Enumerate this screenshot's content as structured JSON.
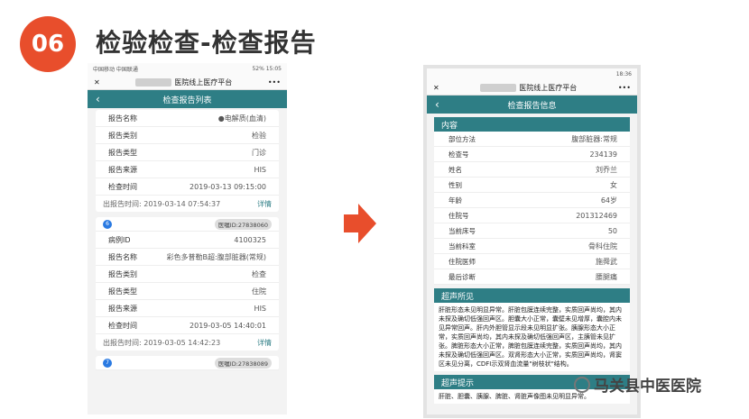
{
  "slide": {
    "badge": "06",
    "title": "检验检查-检查报告"
  },
  "left_phone": {
    "status_left": "中国移动 中国联通",
    "status_right": "52% 15:05",
    "app_title": "医院线上医疗平台",
    "nav_title": "检查报告列表",
    "card1": {
      "rows": [
        {
          "label": "报告名称",
          "value": "●电解质(血清)"
        },
        {
          "label": "报告类别",
          "value": "检验"
        },
        {
          "label": "报告类型",
          "value": "门诊"
        },
        {
          "label": "报告来源",
          "value": "HIS"
        },
        {
          "label": "检查时间",
          "value": "2019-03-13 09:15:00"
        }
      ],
      "footer_time": "出报告时间: 2019-03-14 07:54:37",
      "detail": "详情"
    },
    "card2": {
      "index": "6",
      "tag": "医嘱ID:27838060",
      "rows": [
        {
          "label": "病例ID",
          "value": "4100325"
        },
        {
          "label": "报告名称",
          "value": "彩色多普勒B超:腹部脏器(常规)"
        },
        {
          "label": "报告类别",
          "value": "检查"
        },
        {
          "label": "报告类型",
          "value": "住院"
        },
        {
          "label": "报告来源",
          "value": "HIS"
        },
        {
          "label": "检查时间",
          "value": "2019-03-05 14:40:01"
        }
      ],
      "footer_time": "出报告时间: 2019-03-05 14:42:23",
      "detail": "详情"
    },
    "card3": {
      "index": "7",
      "tag": "医嘱ID:27838089"
    }
  },
  "right_phone": {
    "status_right": "18:36",
    "app_title": "医院线上医疗平台",
    "nav_title": "检查报告信息",
    "content_head": "内容",
    "rows": [
      {
        "label": "部位方法",
        "value": "腹部脏器:常规"
      },
      {
        "label": "检查号",
        "value": "234139"
      },
      {
        "label": "姓名",
        "value": "刘乔兰"
      },
      {
        "label": "性别",
        "value": "女"
      },
      {
        "label": "年龄",
        "value": "64岁"
      },
      {
        "label": "住院号",
        "value": "201312469"
      },
      {
        "label": "当前床号",
        "value": "50"
      },
      {
        "label": "当前科室",
        "value": "骨科住院"
      },
      {
        "label": "住院医师",
        "value": "施舜武"
      },
      {
        "label": "最后诊断",
        "value": "腰腿痛"
      }
    ],
    "findings_head": "超声所见",
    "findings": "肝脏形态未见明显异常。肝脏包膜连续完整，实质回声尚均，其内未探及确切低强回声区。胆囊大小正常，囊壁未见增厚，囊腔内未见异常回声。肝内外胆管显示段未见明显扩张。胰腺形态大小正常，实质回声尚均，其内未探及确切低强回声区，主胰管未见扩张。脾脏形态大小正常，脾脏包膜连续完整，实质回声尚均，其内未探及确切低强回声区。双肾形态大小正常，实质回声尚均，肾窦区未见分离，CDFI示双肾血流量\"树枝状\"结构。",
    "hint_head": "超声提示",
    "hint": "肝脏、胆囊、胰腺、脾脏、肾脏声像图未见明显异常。"
  },
  "watermark": "马关县中医医院",
  "colors": {
    "accent": "#2e7e85",
    "badge": "#e84e2c",
    "arrow": "#e84e2c"
  }
}
